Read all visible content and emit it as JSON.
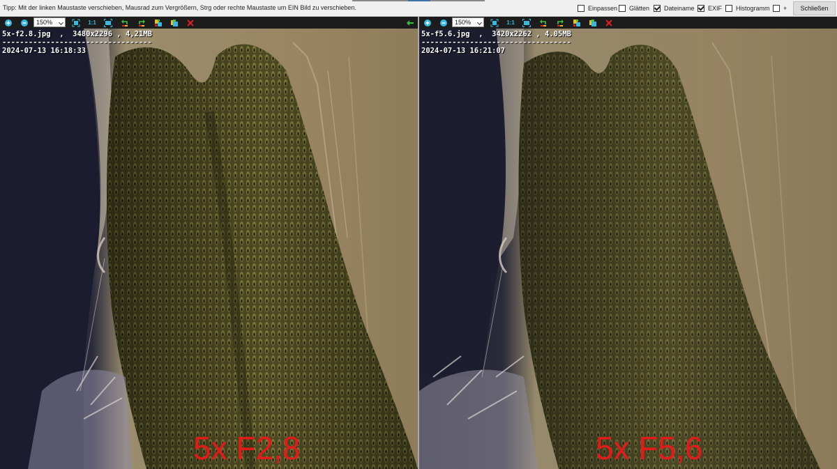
{
  "tip": "Tipp: Mit der linken Maustaste verschieben, Mausrad zum Vergrößern, Strg oder rechte Maustaste um EIN Bild zu verschieben.",
  "options": [
    {
      "label": "Einpassen",
      "checked": false
    },
    {
      "label": "Glätten",
      "checked": false
    },
    {
      "label": "Dateiname",
      "checked": true
    },
    {
      "label": "EXIF",
      "checked": true
    },
    {
      "label": "Histogramm",
      "checked": false
    },
    {
      "label": "+",
      "checked": false
    }
  ],
  "close_label": "Schließen",
  "toolbar": {
    "icons": [
      "zoom-in-icon",
      "zoom-out-icon",
      "zoom-select",
      "fit-icon",
      "one-to-one-icon",
      "fullscreen-icon",
      "rotate-left-icon",
      "rotate-right-icon",
      "color-icon",
      "copy-icon",
      "delete-icon"
    ],
    "one_to_one": "1:1",
    "colors": {
      "blue": "#39b8e0",
      "green": "#3ec13e",
      "red": "#e02020",
      "yellow": "#e8c020"
    }
  },
  "panels": [
    {
      "zoom": "150%",
      "filename": "5x-f2.8.jpg",
      "dimensions": "3480x2296",
      "size": "4,21MB",
      "separator": "----------------------------------",
      "date": "2024-07-13 16:18:33",
      "caption": "5x F2,8"
    },
    {
      "zoom": "150%",
      "filename": "5x-f5.6.jpg",
      "dimensions": "3420x2262",
      "size": "4.05MB",
      "separator": "----------------------------------",
      "date": "2024-07-13 16:21:07",
      "caption": "5x F5,6"
    }
  ],
  "caption_color": "#e41a1a"
}
